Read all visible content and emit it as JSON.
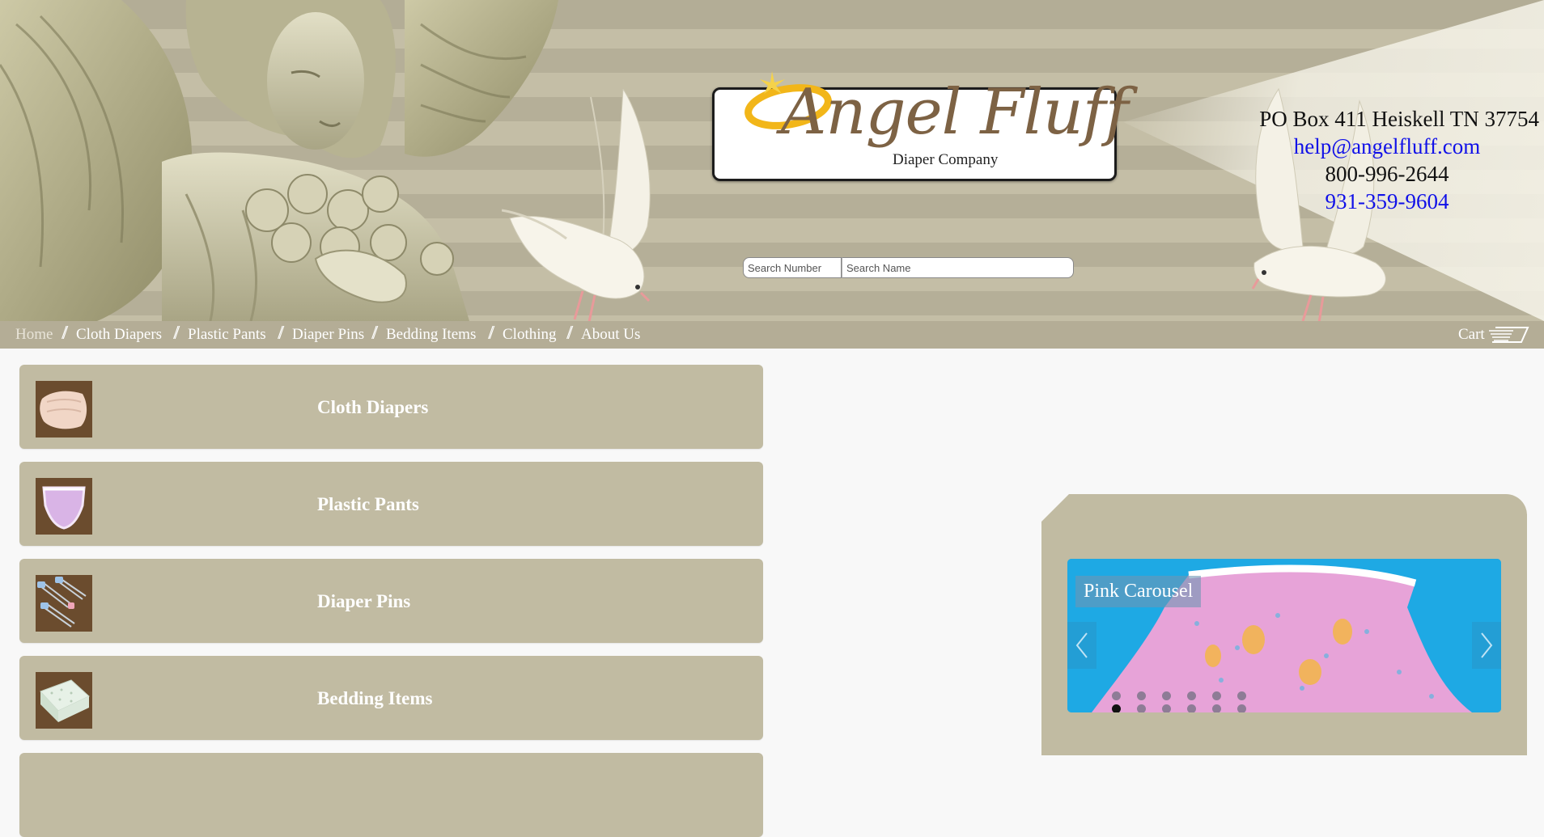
{
  "header": {
    "logo": {
      "title": "Angel Fluff",
      "subtitle": "Diaper Company"
    },
    "search": {
      "number_placeholder": "Search Number",
      "name_placeholder": "Search Name"
    },
    "contact": {
      "address": "PO Box 411 Heiskell TN 37754",
      "email": "help@angelfluff.com",
      "phone1": "800-996-2644",
      "phone2": "931-359-9604"
    }
  },
  "nav": {
    "items": [
      {
        "label": "Home",
        "active": true
      },
      {
        "label": "Cloth Diapers"
      },
      {
        "label": "Plastic Pants"
      },
      {
        "label": "Diaper Pins"
      },
      {
        "label": "Bedding Items"
      },
      {
        "label": "Clothing"
      },
      {
        "label": "About Us"
      }
    ],
    "cart_label": "Cart"
  },
  "categories": [
    {
      "label": "Cloth Diapers",
      "icon": "folded-diaper-thumbnail"
    },
    {
      "label": "Plastic Pants",
      "icon": "plastic-pants-thumbnail"
    },
    {
      "label": "Diaper Pins",
      "icon": "diaper-pins-thumbnail"
    },
    {
      "label": "Bedding Items",
      "icon": "bedding-pad-thumbnail"
    }
  ],
  "slider": {
    "caption": "Pink Carousel",
    "dot_count": 12,
    "active_dot": 6
  },
  "colors": {
    "header_stripe_dark": "#b5af98",
    "header_stripe_light": "#c4bea6",
    "nav_bg": "#b4ad96",
    "category_bg": "#c1bba2",
    "logo_brown": "#7d6244",
    "halo_gold": "#f2b619",
    "link_blue": "#1010e8"
  }
}
